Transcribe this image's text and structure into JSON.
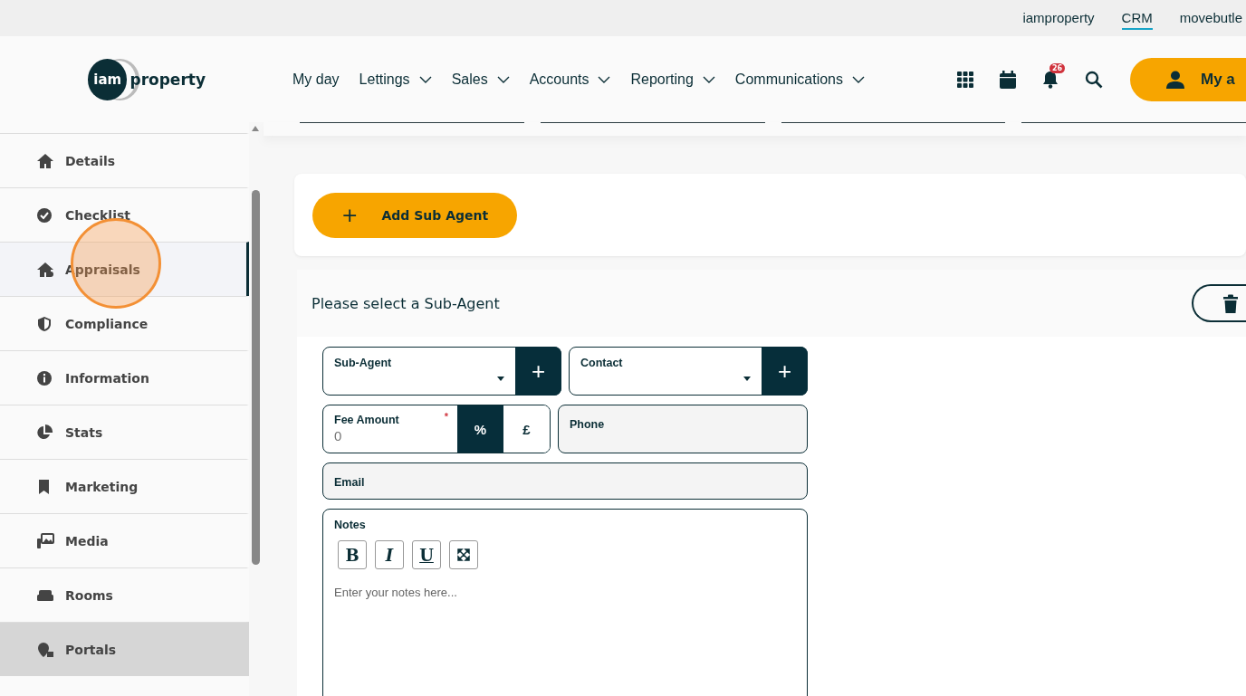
{
  "top_links": [
    {
      "label": "iamproperty",
      "selected": false
    },
    {
      "label": "CRM",
      "selected": true
    },
    {
      "label": "movebutle",
      "selected": false
    }
  ],
  "logo": {
    "left": "iam",
    "right": "property"
  },
  "nav": [
    {
      "label": "My day",
      "dropdown": false
    },
    {
      "label": "Lettings",
      "dropdown": true
    },
    {
      "label": "Sales",
      "dropdown": true
    },
    {
      "label": "Accounts",
      "dropdown": true
    },
    {
      "label": "Reporting",
      "dropdown": true
    },
    {
      "label": "Communications",
      "dropdown": true
    }
  ],
  "notifications": {
    "count": "26"
  },
  "account_button": {
    "label": "My a"
  },
  "sidebar": {
    "items": [
      {
        "label": "Details",
        "selected": false,
        "highlighted": false
      },
      {
        "label": "Checklist",
        "selected": false,
        "highlighted": false
      },
      {
        "label": "Appraisals",
        "selected": true,
        "highlighted": false
      },
      {
        "label": "Compliance",
        "selected": false,
        "highlighted": false
      },
      {
        "label": "Information",
        "selected": false,
        "highlighted": false
      },
      {
        "label": "Stats",
        "selected": false,
        "highlighted": false
      },
      {
        "label": "Marketing",
        "selected": false,
        "highlighted": false
      },
      {
        "label": "Media",
        "selected": false,
        "highlighted": false
      },
      {
        "label": "Rooms",
        "selected": false,
        "highlighted": false
      },
      {
        "label": "Portals",
        "selected": false,
        "highlighted": true
      }
    ]
  },
  "add_button": {
    "icon": "+",
    "label": "Add Sub Agent"
  },
  "panel": {
    "title": "Please select a Sub-Agent",
    "sub_agent": {
      "label": "Sub-Agent",
      "add": "+"
    },
    "contact": {
      "label": "Contact",
      "add": "+"
    },
    "fee": {
      "label": "Fee Amount",
      "required": "*",
      "placeholder": "0",
      "units": [
        {
          "label": "%",
          "selected": true
        },
        {
          "label": "£",
          "selected": false
        }
      ]
    },
    "phone": {
      "label": "Phone"
    },
    "email": {
      "label": "Email"
    },
    "notes": {
      "label": "Notes",
      "toolbar": [
        "B",
        "I",
        "U"
      ],
      "placeholder": "Enter your notes here..."
    }
  }
}
